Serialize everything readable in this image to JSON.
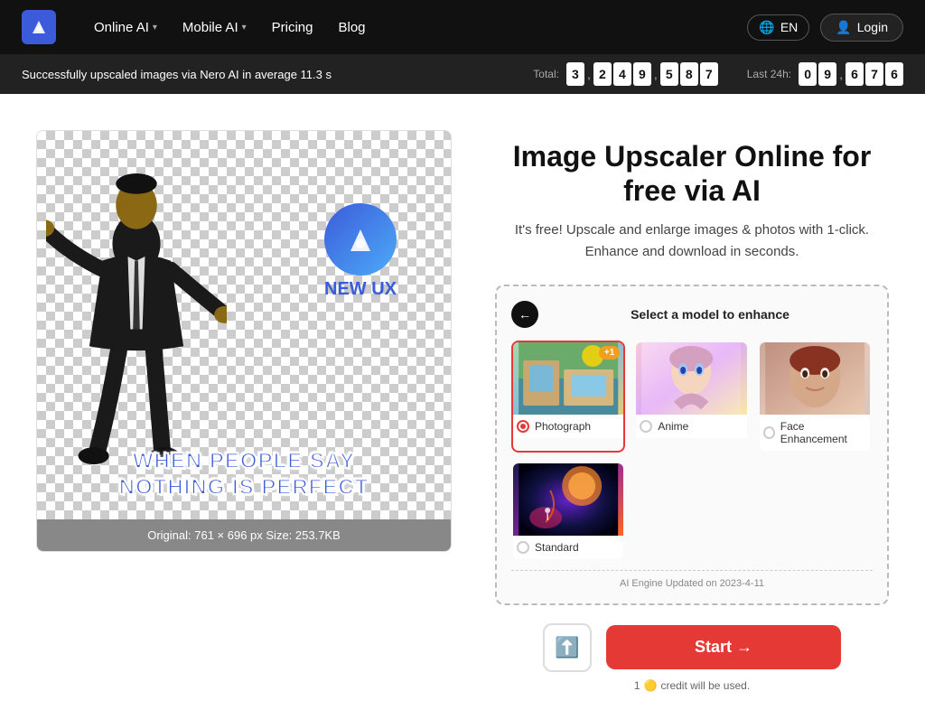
{
  "navbar": {
    "logo_text": "AI",
    "links": [
      {
        "label": "Online AI",
        "has_dropdown": true
      },
      {
        "label": "Mobile AI",
        "has_dropdown": true
      },
      {
        "label": "Pricing",
        "has_dropdown": false
      },
      {
        "label": "Blog",
        "has_dropdown": false
      }
    ],
    "lang_button": "EN",
    "login_button": "Login"
  },
  "ticker": {
    "message": "Successfully upscaled images via Nero AI in average 11.3 s",
    "total_label": "Total:",
    "total_digits": [
      "3",
      "2",
      "4",
      "9",
      "5",
      "8",
      "7"
    ],
    "total_commas": [
      1,
      4
    ],
    "last24h_label": "Last 24h:",
    "last24h_digits": [
      "0",
      "9",
      "6",
      "7",
      "6"
    ],
    "last24h_commas": [
      2
    ]
  },
  "hero": {
    "title": "Image Upscaler Online for free via AI",
    "subtitle": "It's free! Upscale and enlarge images & photos with 1-click. Enhance and download in seconds."
  },
  "model_selector": {
    "header": "Select a model to enhance",
    "models": [
      {
        "id": "photograph",
        "label": "Photograph",
        "selected": true,
        "badge": "+1"
      },
      {
        "id": "anime",
        "label": "Anime",
        "selected": false,
        "badge": null
      },
      {
        "id": "face",
        "label": "Face Enhancement",
        "selected": false,
        "badge": null
      },
      {
        "id": "standard",
        "label": "Standard",
        "selected": false,
        "badge": null
      }
    ],
    "engine_note": "AI Engine Updated on 2023-4-11"
  },
  "image_preview": {
    "meme_text": "WHEN PEOPLE SAY NOTHING IS PERFECT",
    "ai_badge": "NEW UX",
    "caption": "Original: 761 × 696 px   Size: 253.7KB"
  },
  "actions": {
    "start_label": "Start →",
    "credit_note": "1",
    "credit_suffix": "credit will be used."
  }
}
